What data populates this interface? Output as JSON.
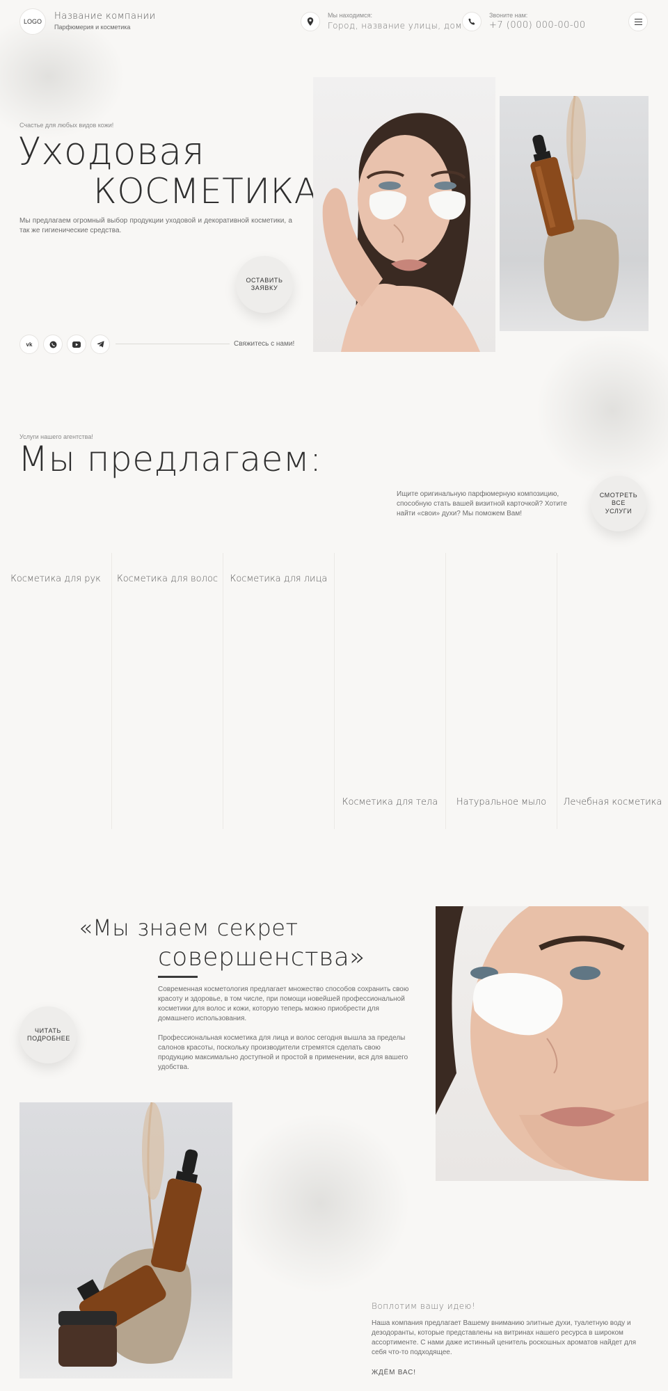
{
  "header": {
    "logo": "LOGO",
    "company_name": "Название компании",
    "company_sub": "Парфюмерия и косметика",
    "location_label": "Мы находимся:",
    "location_value": "Город, название улицы, дом",
    "phone_label": "Звоните нам:",
    "phone_value": "+7 (000) 000-00-00"
  },
  "hero": {
    "tagline": "Счастье для любых видов кожи!",
    "title_line1": "Уходовая",
    "title_line2": "КОСМЕТИКА",
    "description": "Мы предлагаем огромный выбор продукции уходовой и декоративной косметики, а так же гигиенические средства.",
    "cta": "ОСТАВИТЬ ЗАЯВКУ",
    "contact_text": "Свяжитесь с нами!",
    "socials": [
      "vk-icon",
      "whatsapp-icon",
      "youtube-icon",
      "telegram-icon"
    ]
  },
  "services": {
    "tagline": "Услуги нашего агентства!",
    "title": "Мы предлагаем:",
    "description": "Ищите оригинальную парфюмерную композицию, способную стать вашей визитной карточкой? Хотите найти «свои» духи? Мы поможем Вам!",
    "cta": "СМОТРЕТЬ ВСЕ УСЛУГИ",
    "categories": [
      {
        "label": "Косметика для рук"
      },
      {
        "label": "Косметика для волос"
      },
      {
        "label": "Косметика для лица"
      },
      {
        "label": "Косметика для тела"
      },
      {
        "label": "Натуральное мыло"
      },
      {
        "label": "Лечебная косметика"
      }
    ]
  },
  "about": {
    "quote_line1": "«Мы знаем секрет",
    "quote_line2": "совершенства»",
    "para1": "Современная косметология предлагает множество способов сохранить свою красоту и здоровье, в том числе, при помощи новейшей профессиональной косметики для волос и кожи, которую теперь можно приобрести для домашнего использования.",
    "para2": "Профессиональная косметика для лица и волос сегодня вышла за пределы салонов красоты, поскольку производители стремятся сделать свою продукцию максимально доступной и простой в применении, вся для вашего удобства.",
    "cta": "ЧИТАТЬ ПОДРОБНЕЕ"
  },
  "bottom": {
    "heading": "Воплотим вашу идею!",
    "text": "Наша компания предлагает Вашему вниманию элитные духи, туалетную воду и дезодоранты, которые представлены на витринах нашего ресурса в широком ассортименте. С нами даже истинный ценитель роскошных ароматов найдет для себя что-то подходящее.",
    "closing": "ЖДЁМ ВАС!"
  },
  "colors": {
    "background": "#f8f7f5",
    "text": "#2e2e2e",
    "button_bg": "#eeedeb"
  }
}
